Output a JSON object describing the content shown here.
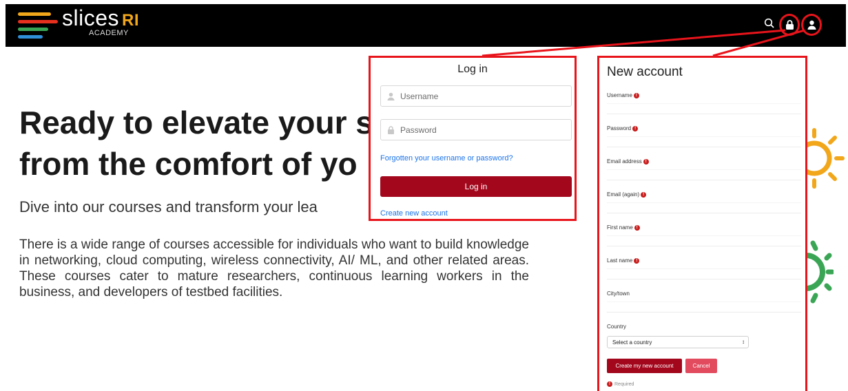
{
  "brand": {
    "name": "slices",
    "suffix": "RI",
    "sub": "ACADEMY",
    "line_colors": [
      "#f2a71b",
      "#e8301e",
      "#3aa655",
      "#2f8fd8"
    ]
  },
  "header_icons": [
    "search-icon",
    "lock-icon",
    "user-icon"
  ],
  "hero": {
    "title_line1": "Ready to elevate your s",
    "title_line2": "from the comfort of yo",
    "subtitle": "Dive into our courses and transform your lea",
    "paragraph": "There is a wide range of courses accessible for individuals who want to build knowledge in networking, cloud computing, wireless connectivity, AI/ ML, and other related areas. These courses cater to mature researchers, continuous learning workers in the business, and developers of testbed facilities."
  },
  "login": {
    "title": "Log in",
    "username_placeholder": "Username",
    "password_placeholder": "Password",
    "forgot_link": "Forgotten your username or password?",
    "submit_label": "Log in",
    "create_link": "Create new account"
  },
  "new_account": {
    "title": "New account",
    "fields": [
      {
        "label": "Username",
        "required": true
      },
      {
        "label": "Password",
        "required": true
      },
      {
        "label": "Email address",
        "required": true
      },
      {
        "label": "Email (again)",
        "required": true
      },
      {
        "label": "First name",
        "required": true
      },
      {
        "label": "Last name",
        "required": true
      },
      {
        "label": "City/town",
        "required": false
      }
    ],
    "country_label": "Country",
    "country_value": "Select a country",
    "create_label": "Create my new account",
    "cancel_label": "Cancel",
    "required_note": "Required",
    "required_mark": "!"
  },
  "colors": {
    "accent_red": "#a3071c",
    "highlight_red": "#e8141b",
    "link": "#1a73e8",
    "gear_orange": "#f2a71b",
    "gear_green": "#3aa655"
  }
}
